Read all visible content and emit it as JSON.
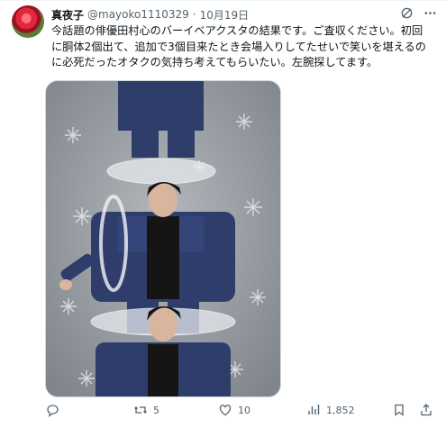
{
  "tweet": {
    "author_name": "真夜子",
    "author_handle": "@mayoko1110329",
    "separator": "·",
    "date": "10月19日",
    "text_lines": [
      "今話題の俳優田村心のバーイベアクスタの結果です。ご査収ください。初回",
      "に胴体2個出て、追加で3個目来たとき会場入りしてたせいで笑いを堪えるの",
      "に必死だったオタクの気持ち考えてもらいたい。左腕探してます。"
    ],
    "top_icons": [
      "grok-icon",
      "more-icon"
    ]
  },
  "actions": {
    "reply": {
      "icon": "reply-icon",
      "count": ""
    },
    "retweet": {
      "icon": "retweet-icon",
      "count": "5"
    },
    "like": {
      "icon": "like-icon",
      "count": "10"
    },
    "views": {
      "icon": "views-icon",
      "count": "1,852"
    },
    "bookmark": {
      "icon": "bookmark-icon"
    },
    "share": {
      "icon": "share-icon"
    }
  },
  "colors": {
    "text": "#0f1419",
    "muted": "#536471",
    "border": "#cfd9de",
    "denim": "#2f3d6b",
    "background_board": "#8d939a"
  }
}
